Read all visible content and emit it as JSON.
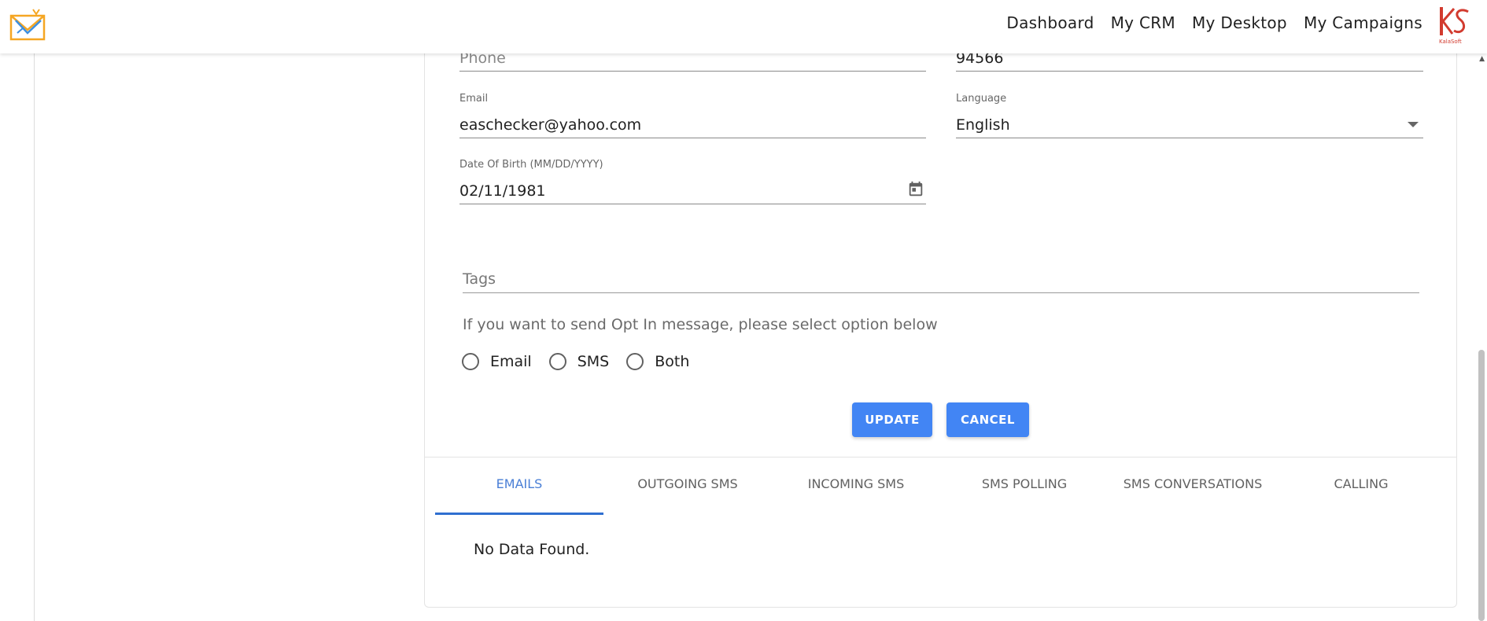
{
  "nav": {
    "links": [
      {
        "label": "Dashboard"
      },
      {
        "label": "My CRM"
      },
      {
        "label": "My Desktop"
      },
      {
        "label": "My Campaigns"
      }
    ],
    "brand_text": "KalaSoft"
  },
  "form": {
    "phone": {
      "value": "Phone"
    },
    "zip": {
      "value": "94566"
    },
    "email": {
      "label": "Email",
      "value": "easchecker@yahoo.com"
    },
    "language": {
      "label": "Language",
      "value": "English"
    },
    "dob": {
      "label": "Date Of Birth (MM/DD/YYYY)",
      "value": "02/11/1981"
    },
    "tags": {
      "placeholder": "Tags"
    },
    "optin": {
      "text": "If you want to send Opt In message, please select option below",
      "options": [
        {
          "label": "Email"
        },
        {
          "label": "SMS"
        },
        {
          "label": "Both"
        }
      ]
    },
    "update_label": "UPDATE",
    "cancel_label": "CANCEL"
  },
  "tabs": [
    {
      "label": "EMAILS"
    },
    {
      "label": "OUTGOING SMS"
    },
    {
      "label": "INCOMING SMS"
    },
    {
      "label": "SMS POLLING"
    },
    {
      "label": "SMS CONVERSATIONS"
    },
    {
      "label": "CALLING"
    }
  ],
  "tab_content": {
    "empty": "No Data Found."
  },
  "colors": {
    "accent": "#4285f4",
    "tab_active": "#4a7fd6",
    "brand_red": "#d23b2f"
  },
  "icons": {
    "app_logo": "envelope-logo",
    "brand_logo": "kalasoft-logo",
    "calendar": "calendar-icon",
    "dropdown": "chevron-down-icon"
  }
}
